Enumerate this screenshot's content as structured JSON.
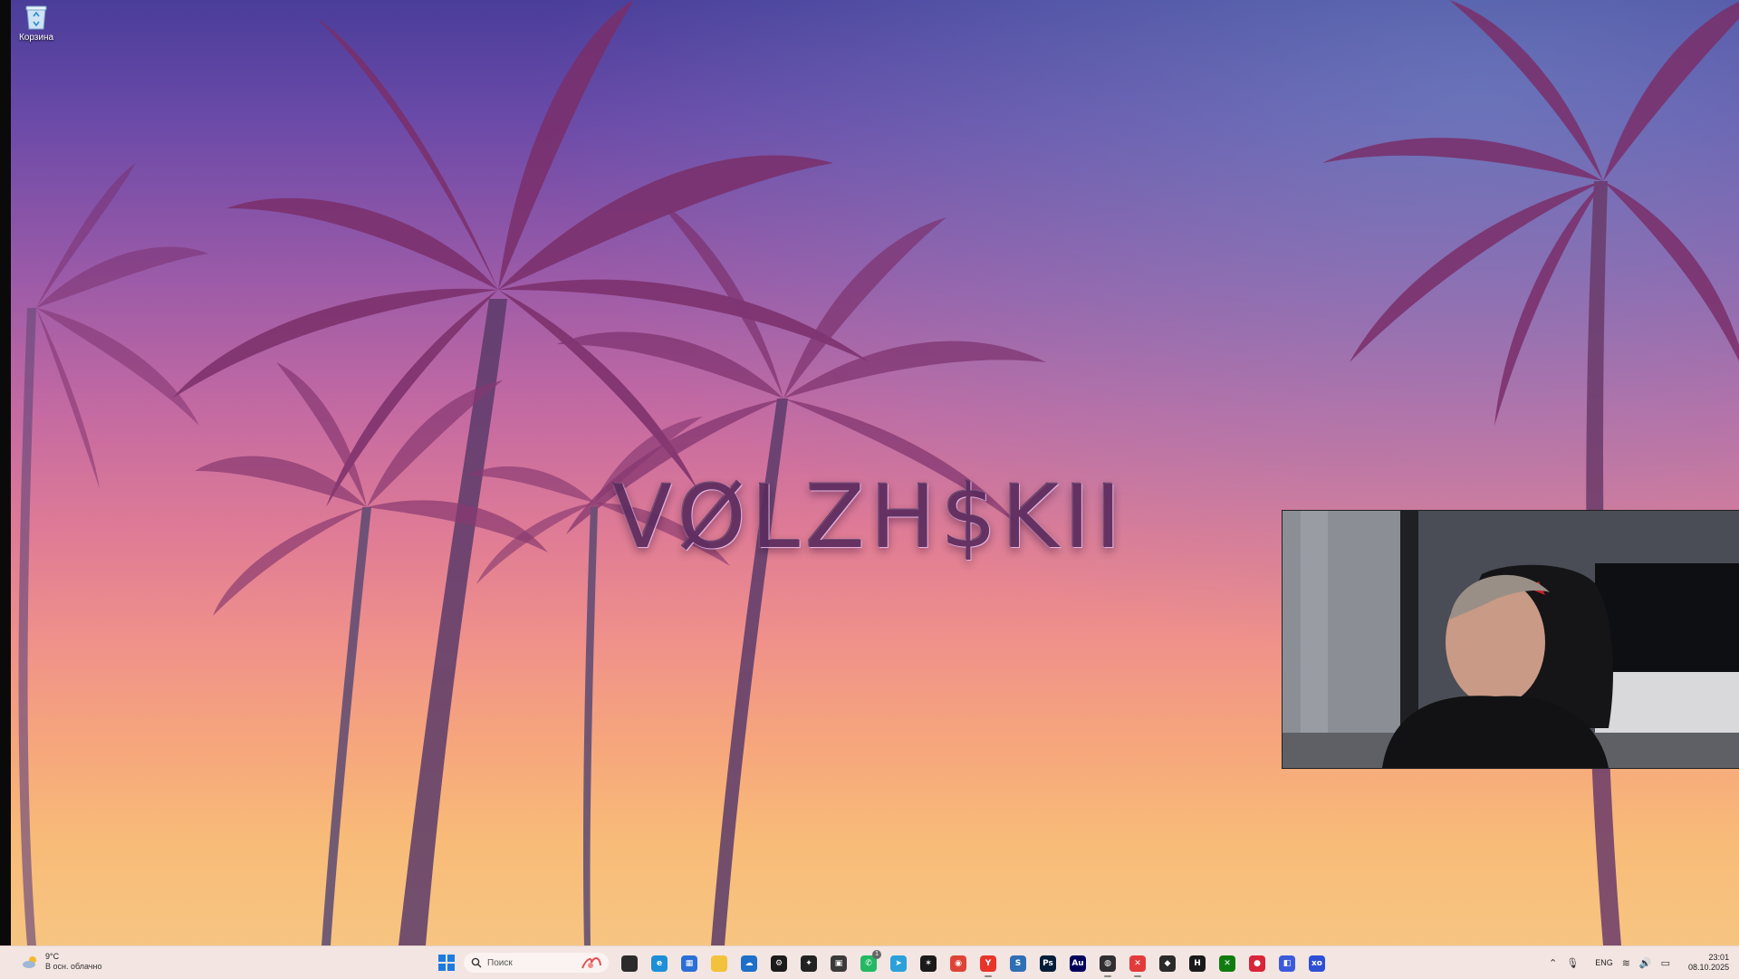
{
  "desktop": {
    "icons": [
      {
        "label": "Корзина",
        "icon": "recycle-bin-icon"
      }
    ],
    "wallpaper_text": "VØLZH$KII"
  },
  "weather": {
    "temperature": "9°C",
    "condition": "В осн. облачно",
    "icon": "partly-cloudy-icon"
  },
  "taskbar": {
    "start_icon": "windows-start-icon",
    "search": {
      "placeholder": "Поиск"
    },
    "apps": [
      {
        "name": "task-view",
        "icon": "task-view-icon",
        "glyph": "",
        "color": "#2b2b2b"
      },
      {
        "name": "edge",
        "icon": "edge-icon",
        "glyph": "e",
        "color": "#1c8fd8"
      },
      {
        "name": "store",
        "icon": "store-icon",
        "glyph": "▦",
        "color": "#2a6fd6"
      },
      {
        "name": "file-explorer",
        "icon": "folder-icon",
        "glyph": "",
        "color": "#f3c23c"
      },
      {
        "name": "onedrive",
        "icon": "cloud-icon",
        "glyph": "☁",
        "color": "#1d6fc9"
      },
      {
        "name": "steam",
        "icon": "steam-icon",
        "glyph": "⚙",
        "color": "#1b1b1b"
      },
      {
        "name": "game-launcher",
        "icon": "launcher-icon",
        "glyph": "✦",
        "color": "#222222"
      },
      {
        "name": "media-app",
        "icon": "media-icon",
        "glyph": "▣",
        "color": "#3a3a3a"
      },
      {
        "name": "whatsapp",
        "icon": "whatsapp-icon",
        "glyph": "✆",
        "color": "#25b864",
        "badge": "1"
      },
      {
        "name": "telegram",
        "icon": "telegram-icon",
        "glyph": "➤",
        "color": "#2aa1da"
      },
      {
        "name": "yellow-app",
        "icon": "star-app-icon",
        "glyph": "✶",
        "color": "#1a1a1a"
      },
      {
        "name": "chrome",
        "icon": "chrome-icon",
        "glyph": "◉",
        "color": "#de4436"
      },
      {
        "name": "yandex-browser",
        "icon": "yandex-icon",
        "glyph": "Y",
        "color": "#e8352b",
        "active": true
      },
      {
        "name": "app-s",
        "icon": "s-app-icon",
        "glyph": "S",
        "color": "#2f6fb5"
      },
      {
        "name": "photoshop",
        "icon": "photoshop-icon",
        "glyph": "Ps",
        "color": "#001e36"
      },
      {
        "name": "audition",
        "icon": "audition-icon",
        "glyph": "Au",
        "color": "#00005b"
      },
      {
        "name": "obs",
        "icon": "obs-icon",
        "glyph": "◍",
        "color": "#302e31",
        "active": true
      },
      {
        "name": "x-app",
        "icon": "x-app-icon",
        "glyph": "✕",
        "color": "#e23b3b",
        "active": true
      },
      {
        "name": "davinci",
        "icon": "davinci-icon",
        "glyph": "◆",
        "color": "#2a2a2a"
      },
      {
        "name": "h-app",
        "icon": "h-app-icon",
        "glyph": "H",
        "color": "#1a1a1a"
      },
      {
        "name": "xbox",
        "icon": "xbox-icon",
        "glyph": "✕",
        "color": "#107c10"
      },
      {
        "name": "red-app",
        "icon": "red-circle-icon",
        "glyph": "●",
        "color": "#d8253a"
      },
      {
        "name": "blue-app",
        "icon": "blue-square-icon",
        "glyph": "◧",
        "color": "#3b5bdb"
      },
      {
        "name": "xo-app",
        "icon": "xo-icon",
        "glyph": "xo",
        "color": "#2d4fd6"
      }
    ]
  },
  "tray": {
    "language": "ENG",
    "time": "23:01",
    "date": "08.10.2025"
  }
}
